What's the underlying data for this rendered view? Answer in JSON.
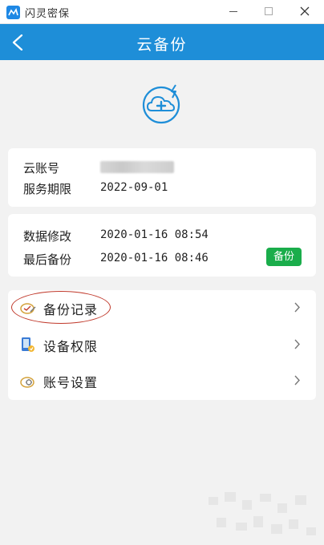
{
  "window": {
    "title": "闪灵密保",
    "min_icon": "minimize-icon",
    "max_icon": "maximize-icon",
    "close_icon": "close-icon"
  },
  "header": {
    "title": "云备份",
    "back_icon": "back-arrow-icon"
  },
  "hero": {
    "icon": "cloud-plus-icon"
  },
  "account": {
    "account_label": "云账号",
    "service_label": "服务期限",
    "service_value": "2022-09-01"
  },
  "data_info": {
    "modified_label": "数据修改",
    "modified_value": "2020-01-16 08:54",
    "last_backup_label": "最后备份",
    "last_backup_value": "2020-01-16 08:46",
    "backup_button": "备份"
  },
  "menu": {
    "items": [
      {
        "label": "备份记录",
        "icon": "backup-record-icon"
      },
      {
        "label": "设备权限",
        "icon": "device-permission-icon"
      },
      {
        "label": "账号设置",
        "icon": "account-settings-icon"
      }
    ]
  },
  "colors": {
    "header_blue": "#1e8ed8",
    "backup_green": "#1aad4b",
    "background": "#f2f2f2",
    "annotation_red": "#c0392b"
  }
}
